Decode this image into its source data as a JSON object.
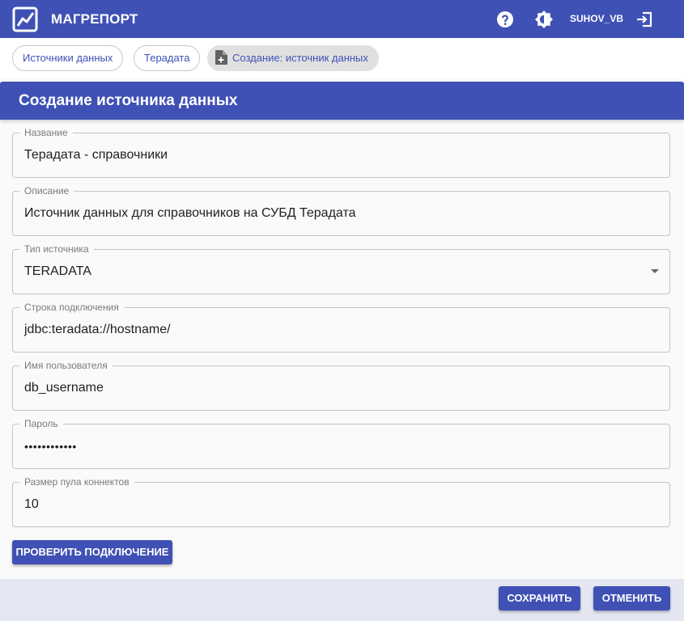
{
  "app": {
    "title": "МАГРЕПОРТ",
    "user": "SUHOV_VB"
  },
  "icons": {
    "logo": "chart-logo-icon",
    "help": "help-icon",
    "theme": "brightness-icon",
    "logout": "logout-icon",
    "new_doc": "file-plus-icon"
  },
  "breadcrumbs": [
    "Источники данных",
    "Терадата",
    "Создание: источник данных"
  ],
  "form": {
    "title": "Создание источника данных",
    "fields": [
      {
        "label": "Название",
        "value": "Терадата - справочники"
      },
      {
        "label": "Описание",
        "value": "Источник данных для справочников на СУБД Терадата"
      },
      {
        "label": "Тип источника",
        "value": "TERADATA"
      },
      {
        "label": "Строка подключения",
        "value": "jdbc:teradata://hostname/"
      },
      {
        "label": "Имя пользователя",
        "value": "db_username"
      },
      {
        "label": "Пароль",
        "value": "••••••••••••"
      },
      {
        "label": "Размер пула коннектов",
        "value": "10"
      }
    ],
    "test_button": "ПРОВЕРИТЬ ПОДКЛЮЧЕНИЕ"
  },
  "footer": {
    "save": "СОХРАНИТЬ",
    "cancel": "ОТМЕНИТЬ"
  },
  "colors": {
    "primary": "#3f51b5",
    "footer_bg": "#e4e7f2",
    "panel_bg": "#fafafa"
  }
}
